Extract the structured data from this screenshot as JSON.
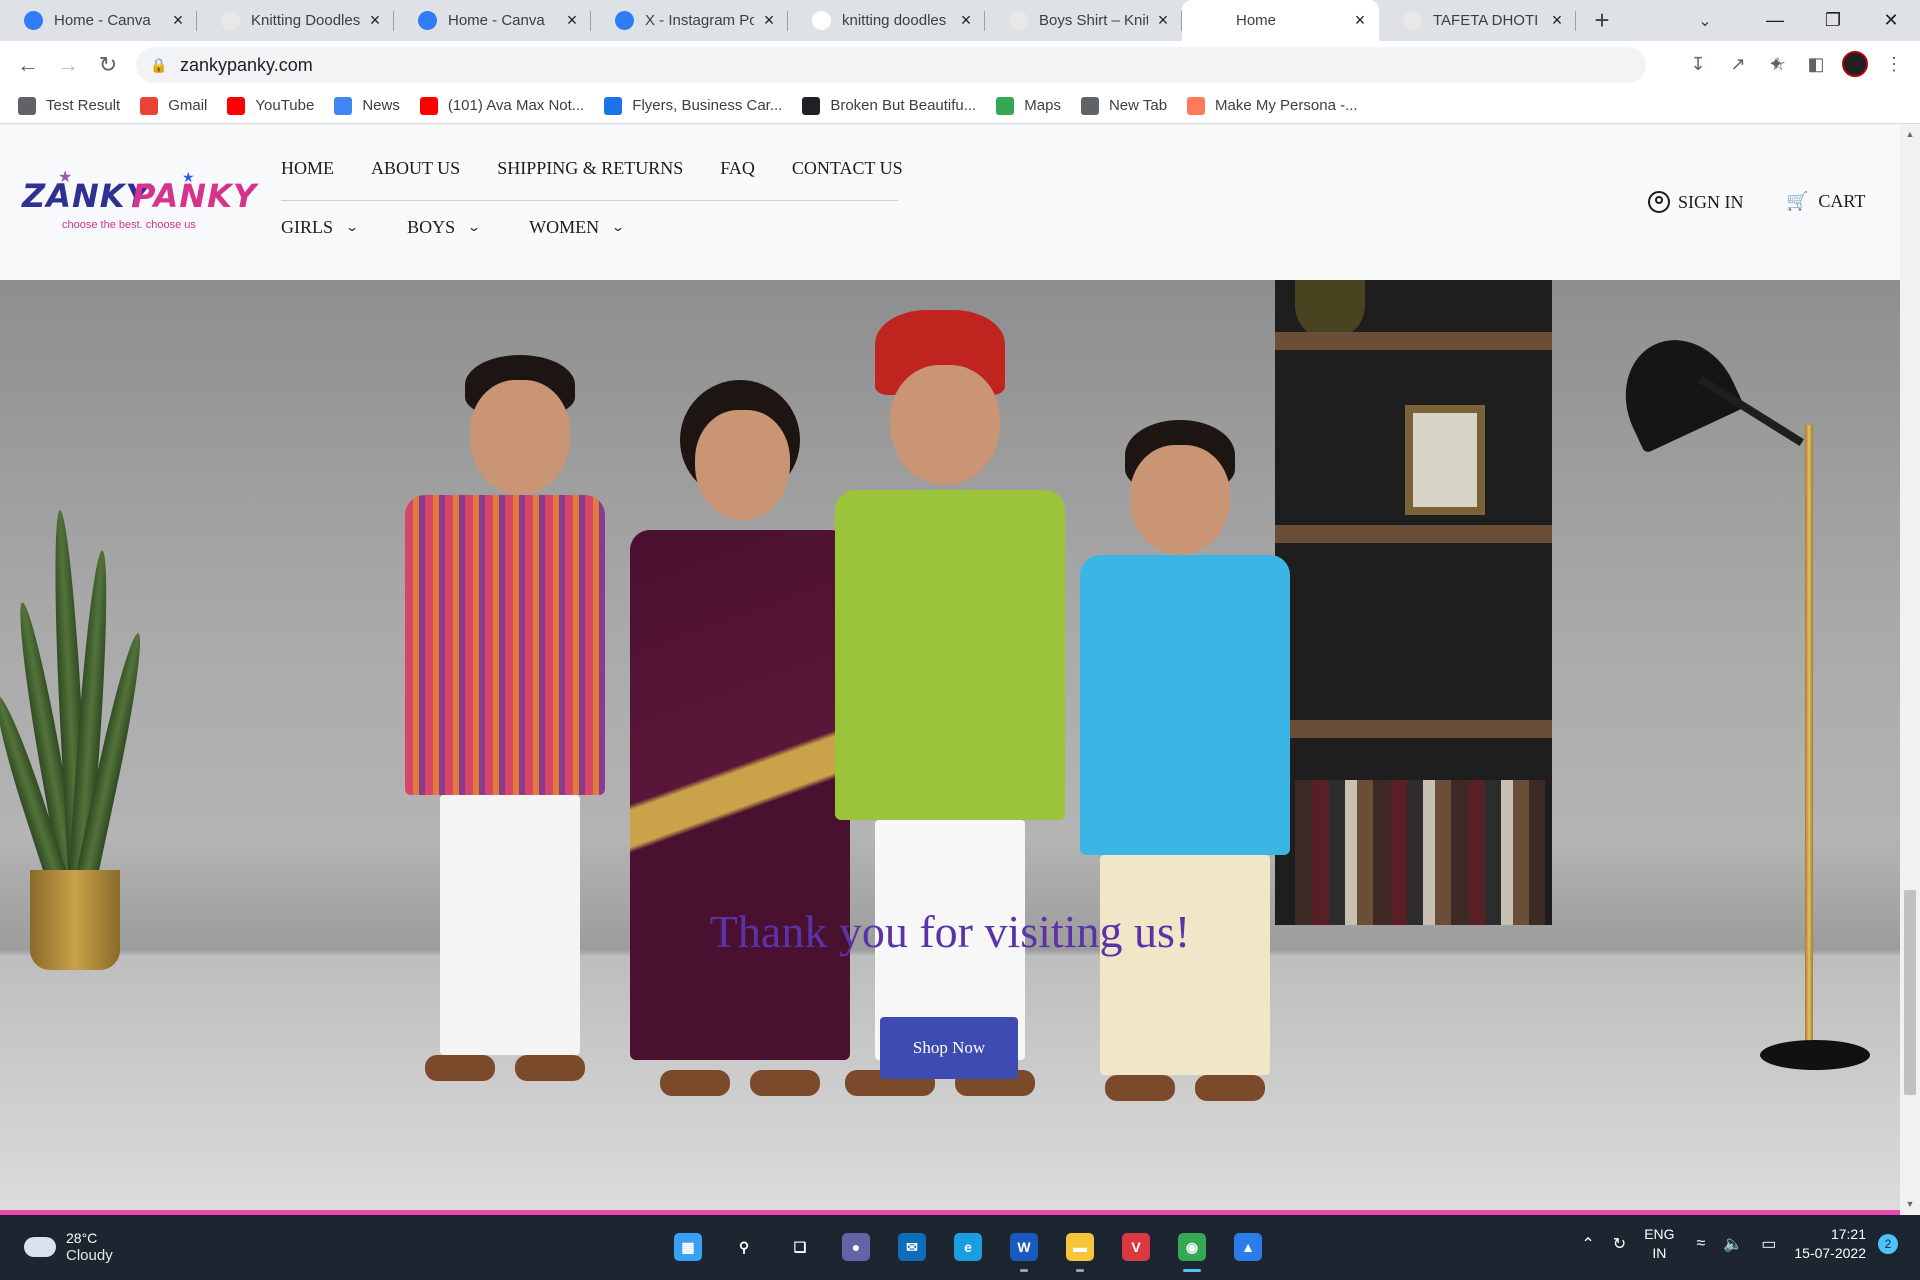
{
  "browser": {
    "tabs": [
      {
        "title": "Home - Canva",
        "favicon": "canva-icon",
        "color": "#2e7cf6",
        "active": false
      },
      {
        "title": "Knitting Doodles |",
        "favicon": "zankypanky-favicon",
        "color": "#e8e8e8",
        "active": false
      },
      {
        "title": "Home - Canva",
        "favicon": "canva-icon",
        "color": "#2e7cf6",
        "active": false
      },
      {
        "title": "X - Instagram Pos",
        "favicon": "canva-icon",
        "color": "#2e7cf6",
        "active": false
      },
      {
        "title": "knitting doodles",
        "favicon": "google-icon",
        "color": "#ffffff",
        "active": false
      },
      {
        "title": "Boys Shirt – Knitti",
        "favicon": "zankypanky-favicon",
        "color": "#e8e8e8",
        "active": false
      },
      {
        "title": "Home",
        "favicon": "zankypanky-favicon",
        "color": "#ffffff",
        "active": true
      },
      {
        "title": "TAFETA DHOTI KU",
        "favicon": "zankypanky-favicon",
        "color": "#e8e8e8",
        "active": false
      }
    ],
    "new_tab": "+",
    "url": "zankypanky.com"
  },
  "bookmarks": [
    {
      "label": "Test Result",
      "icon": "globe-icon",
      "color": "#5f6368"
    },
    {
      "label": "Gmail",
      "icon": "gmail-icon",
      "color": "#ea4335"
    },
    {
      "label": "YouTube",
      "icon": "youtube-icon",
      "color": "#ff0000"
    },
    {
      "label": "News",
      "icon": "news-icon",
      "color": "#4285f4"
    },
    {
      "label": "(101) Ava Max Not...",
      "icon": "youtube-icon",
      "color": "#ff0000"
    },
    {
      "label": "Flyers, Business Car...",
      "icon": "info-icon",
      "color": "#1a73e8"
    },
    {
      "label": "Broken But Beautifu...",
      "icon": "app-icon",
      "color": "#202124"
    },
    {
      "label": "Maps",
      "icon": "maps-icon",
      "color": "#34a853"
    },
    {
      "label": "New Tab",
      "icon": "globe-icon",
      "color": "#5f6368"
    },
    {
      "label": "Make My Persona -...",
      "icon": "hubspot-icon",
      "color": "#ff7a59"
    }
  ],
  "site": {
    "logo_word1": "ZANKY",
    "logo_word2": "PANKY",
    "logo_tagline": "choose the best. choose us",
    "nav": [
      "HOME",
      "ABOUT US",
      "SHIPPING & RETURNS",
      "FAQ",
      "CONTACT US"
    ],
    "subnav": [
      "GIRLS",
      "BOYS",
      "WOMEN"
    ],
    "sign_in": "SIGN IN",
    "cart": "CART",
    "hero_title": "Thank you for visiting us!",
    "shop_button": "Shop Now",
    "accent_pink": "#ea4bb2",
    "accent_blue": "#3e4bb0"
  },
  "taskbar": {
    "weather_temp": "28°C",
    "weather_cond": "Cloudy",
    "lang_line1": "ENG",
    "lang_line2": "IN",
    "time": "17:21",
    "date": "15-07-2022",
    "notification_count": "2",
    "apps": [
      {
        "name": "start-icon",
        "color": "#3aa0f3",
        "active": false
      },
      {
        "name": "search-icon",
        "color": "transparent",
        "active": false
      },
      {
        "name": "task-view-icon",
        "color": "transparent",
        "active": false
      },
      {
        "name": "teams-chat-icon",
        "color": "#6264a7",
        "active": false
      },
      {
        "name": "mail-icon",
        "color": "#0f6cbd",
        "active": false
      },
      {
        "name": "edge-icon",
        "color": "#1b9de2",
        "active": false
      },
      {
        "name": "word-icon",
        "color": "#185abd",
        "active": false
      },
      {
        "name": "file-explorer-icon",
        "color": "#f8c43a",
        "active": false
      },
      {
        "name": "expressvpn-icon",
        "color": "#da3940",
        "active": false
      },
      {
        "name": "chrome-icon",
        "color": "#34a853",
        "active": true
      },
      {
        "name": "photos-icon",
        "color": "#2b7de9",
        "active": false
      }
    ]
  }
}
